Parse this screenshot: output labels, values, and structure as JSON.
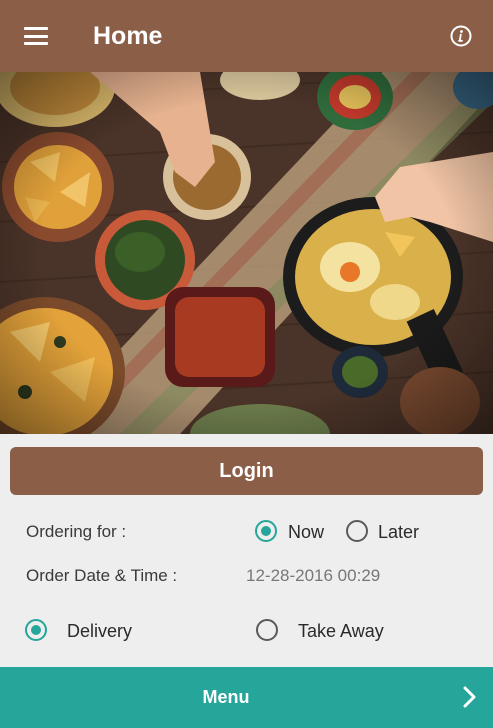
{
  "appbar": {
    "title": "Home",
    "menu_icon": "hamburger-menu-icon",
    "info_icon": "info-icon"
  },
  "hero": {
    "description_icon": "food-table-photo"
  },
  "login": {
    "label": "Login"
  },
  "ordering": {
    "label": "Ordering for :",
    "options": [
      {
        "label": "Now",
        "selected": true
      },
      {
        "label": "Later",
        "selected": false
      }
    ]
  },
  "order_datetime": {
    "label": "Order Date & Time :",
    "value": "12-28-2016 00:29"
  },
  "delivery_type": {
    "options": [
      {
        "label": "Delivery",
        "selected": true
      },
      {
        "label": "Take Away",
        "selected": false
      }
    ]
  },
  "bottom": {
    "label": "Menu",
    "icon": "chevron-right-icon"
  },
  "colors": {
    "brown": "#8b5e48",
    "teal": "#26a69a",
    "background": "#eeeeee"
  }
}
